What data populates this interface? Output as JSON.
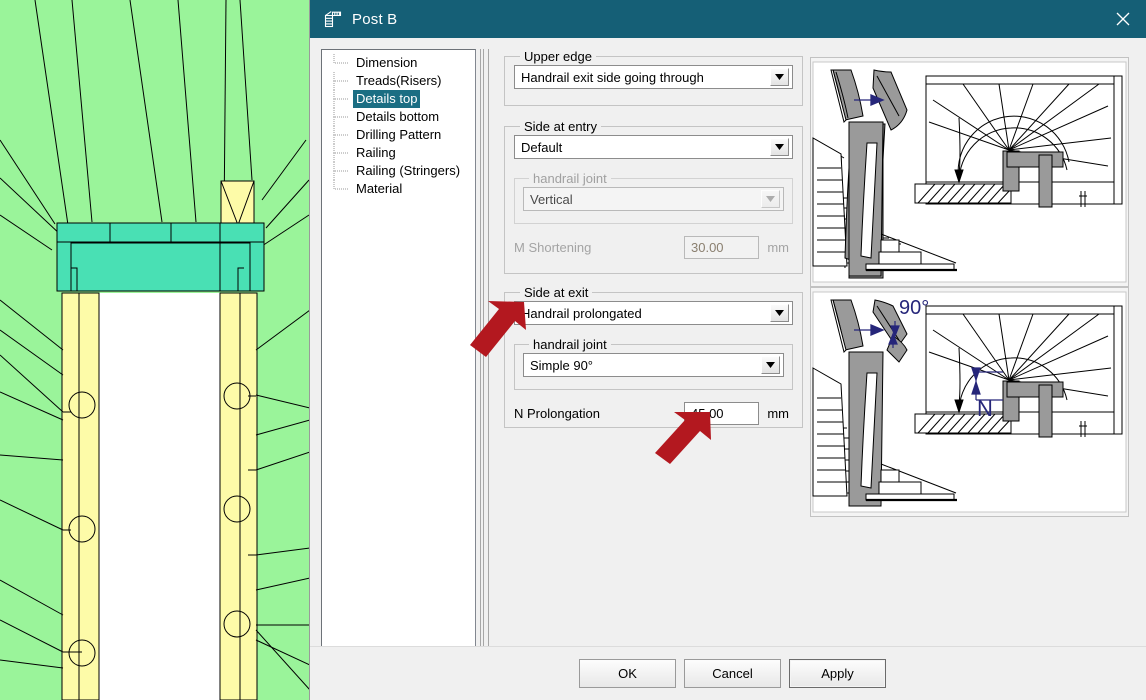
{
  "window": {
    "title": "Post B",
    "icon": "stair-post-icon",
    "close_label": "×",
    "titlebar_color": "#155f76"
  },
  "tree": {
    "name": "settings-category-tree",
    "items": [
      {
        "label": "Dimension",
        "selected": false
      },
      {
        "label": "Treads(Risers)",
        "selected": false
      },
      {
        "label": "Details top",
        "selected": true
      },
      {
        "label": "Details bottom",
        "selected": false
      },
      {
        "label": "Drilling Pattern",
        "selected": false
      },
      {
        "label": "Railing",
        "selected": false
      },
      {
        "label": "Railing (Stringers)",
        "selected": false
      },
      {
        "label": "Material",
        "selected": false
      }
    ],
    "selection_color": "#1b6e83"
  },
  "form": {
    "upper_edge": {
      "legend": "Upper edge",
      "combo_value": "Handrail exit side going through",
      "enabled": true
    },
    "side_at_entry": {
      "legend": "Side at entry",
      "combo_value": "Default",
      "enabled": true,
      "handrail_joint": {
        "legend": "handrail joint",
        "combo_value": "Vertical",
        "enabled": false
      },
      "shortening": {
        "label": "M Shortening",
        "value": "30.00",
        "unit": "mm",
        "enabled": false
      }
    },
    "side_at_exit": {
      "legend": "Side at exit",
      "combo_value": "Handrail prolongated",
      "enabled": true,
      "handrail_joint": {
        "legend": "handrail joint",
        "combo_value": "Simple 90°",
        "enabled": true
      },
      "prolongation": {
        "label": "N Prolongation",
        "value": "45.00",
        "unit": "mm",
        "enabled": true
      }
    }
  },
  "illustrations": {
    "top": {
      "name": "handrail-entry-diagram",
      "annotations": []
    },
    "bottom": {
      "name": "handrail-exit-diagram",
      "annotations": [
        "90°",
        "N"
      ],
      "annotation_color": "#26267a"
    }
  },
  "footer": {
    "ok_label": "OK",
    "cancel_label": "Cancel",
    "apply_label": "Apply"
  },
  "annotations": {
    "arrow_color": "#b3181f",
    "arrow_1_target": "side-at-exit-combo",
    "arrow_2_target": "prolongation-input"
  },
  "cad": {
    "background_fill": "#9af49a",
    "post_fill": "#fdfba8",
    "beam_fill": "#49e0b4",
    "line_color": "#000000"
  }
}
